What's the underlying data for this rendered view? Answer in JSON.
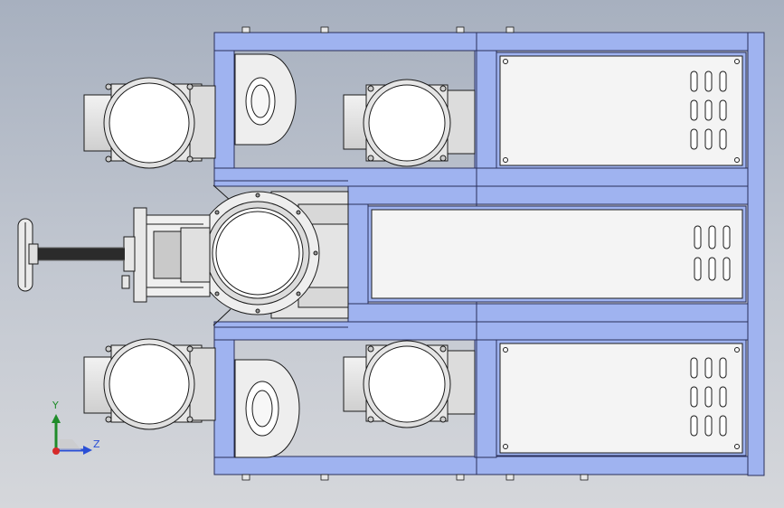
{
  "axis_triad": {
    "y_label": "Y",
    "z_label": "Z"
  },
  "colors": {
    "frame_fill": "#9fb3f0",
    "frame_edge": "#2a2f5a",
    "panel_fill": "#f4f4f4",
    "motor_fill": "#eaeaea",
    "line": "#1b1b1b",
    "axis_y": "#1f8c2a",
    "axis_z": "#2a4fd6",
    "axis_x": "#d62a2a"
  },
  "icons": {
    "handwheel": "handwheel-icon",
    "motor": "motor-icon",
    "vent": "vent-slot-icon",
    "fan": "fan-housing-icon"
  }
}
